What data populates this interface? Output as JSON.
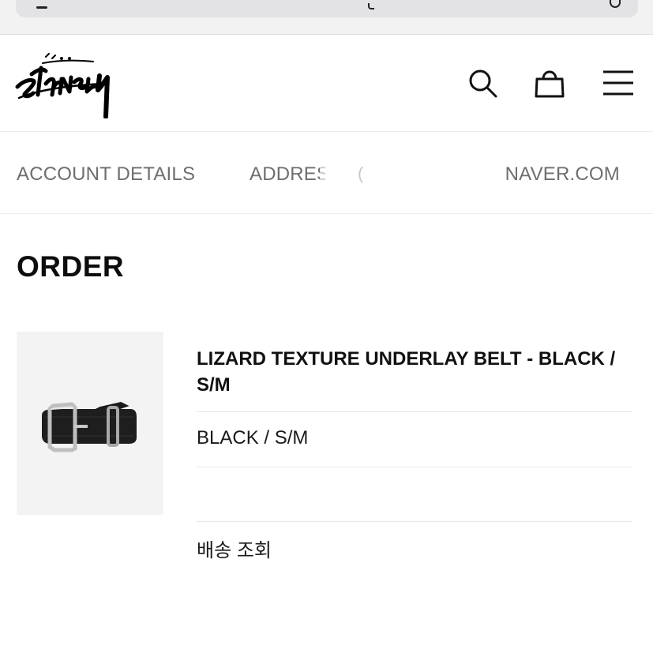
{
  "browser": {
    "url_icons": [
      "menu-icon",
      "lock-icon",
      "reload-icon"
    ]
  },
  "header": {
    "logo_alt": "Stüssy",
    "icons": [
      "search-icon",
      "shopping-bag-icon",
      "hamburger-menu-icon"
    ]
  },
  "account_nav": {
    "tabs": [
      {
        "label": "ACCOUNT DETAILS"
      },
      {
        "label": "ADDRESS"
      },
      {
        "label": "NAVER.COM"
      }
    ],
    "blur_glyph": "("
  },
  "order": {
    "title": "ORDER",
    "item": {
      "name": "LIZARD TEXTURE UNDERLAY BELT - BLACK / S/M",
      "variant": "BLACK / S/M",
      "shipping_link": "배송 조회"
    }
  },
  "colors": {
    "tab_text": "#6e6e6e",
    "product_bg": "#f3f3f3",
    "divider": "#e6e6e6"
  }
}
